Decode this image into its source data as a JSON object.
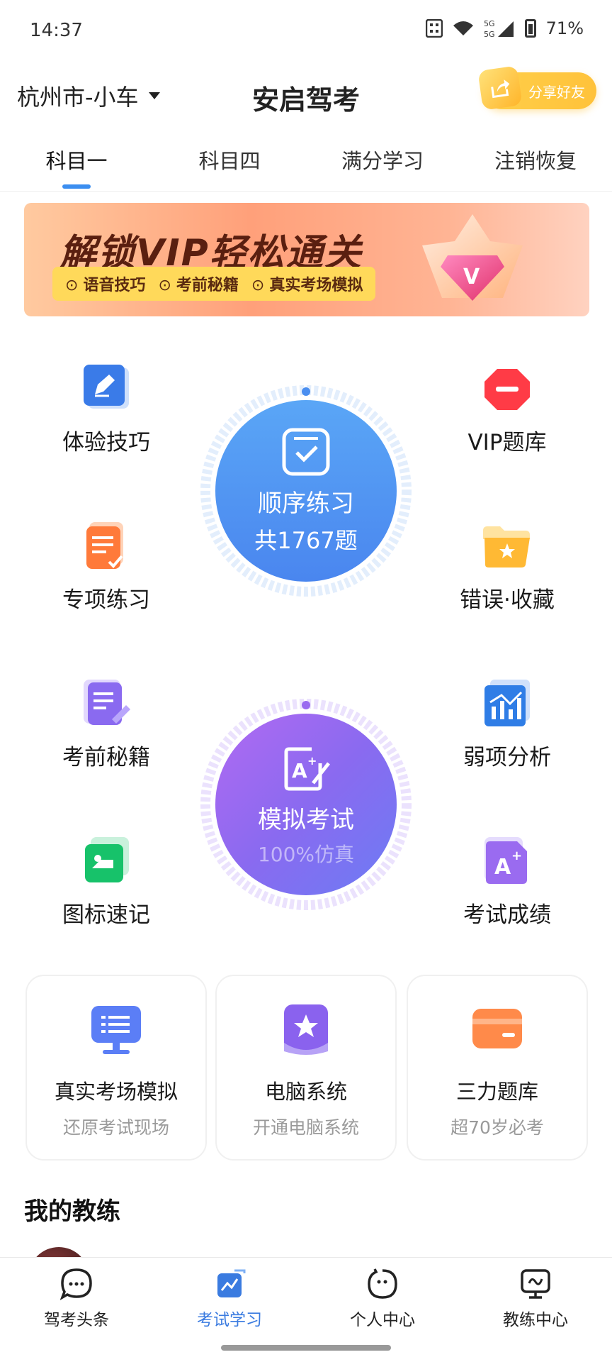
{
  "status_bar": {
    "time": "14:37",
    "network": "5G",
    "battery": "71%"
  },
  "header": {
    "city": "杭州市-小车",
    "title": "安启驾考",
    "share_label": "分享好友"
  },
  "tabs": [
    {
      "label": "科目一",
      "active": true
    },
    {
      "label": "科目四",
      "active": false
    },
    {
      "label": "满分学习",
      "active": false
    },
    {
      "label": "注销恢复",
      "active": false
    }
  ],
  "banner": {
    "title": "解锁VIP轻松通关",
    "features": [
      "语音技巧",
      "考前秘籍",
      "真实考场模拟"
    ]
  },
  "features": {
    "tips": "体验技巧",
    "vip_bank": "VIP题库",
    "special": "专项练习",
    "mistakes": "错误·收藏",
    "secrets": "考前秘籍",
    "weak": "弱项分析",
    "signs": "图标速记",
    "scores": "考试成绩"
  },
  "sequential_practice": {
    "label": "顺序练习",
    "count": "共1767题"
  },
  "mock_exam": {
    "label": "模拟考试",
    "sub": "100%仿真"
  },
  "cards": [
    {
      "title": "真实考场模拟",
      "subtitle": "还原考试现场"
    },
    {
      "title": "电脑系统",
      "subtitle": "开通电脑系统"
    },
    {
      "title": "三力题库",
      "subtitle": "超70岁必考"
    }
  ],
  "coach_section": {
    "title": "我的教练"
  },
  "bottom_nav": [
    {
      "label": "驾考头条",
      "icon": "chat-bubble-icon",
      "active": false
    },
    {
      "label": "考试学习",
      "icon": "study-icon",
      "active": true
    },
    {
      "label": "个人中心",
      "icon": "profile-icon",
      "active": false
    },
    {
      "label": "教练中心",
      "icon": "coach-icon",
      "active": false
    }
  ],
  "colors": {
    "accent": "#3b8ef0",
    "sequential": "#4a8ef0",
    "mock": "#8a6af0",
    "share": "#ffc23a"
  }
}
